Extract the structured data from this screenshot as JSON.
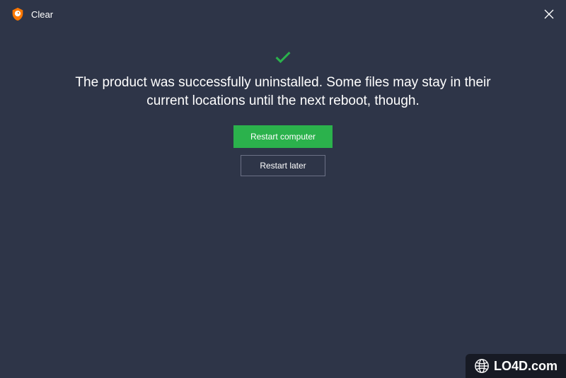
{
  "titlebar": {
    "title": "Clear"
  },
  "main": {
    "message": "The product was successfully uninstalled. Some files may stay in their current locations until the next reboot, though.",
    "primary_button_label": "Restart computer",
    "secondary_button_label": "Restart later"
  },
  "watermark": {
    "text": "LO4D.com"
  },
  "colors": {
    "background": "#2e3548",
    "accent_green": "#2bb24c",
    "logo_orange": "#ff7800"
  }
}
